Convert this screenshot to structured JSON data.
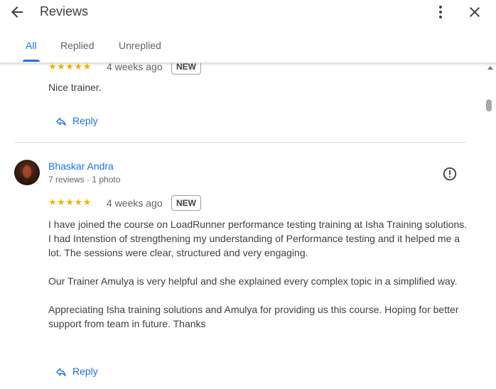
{
  "header": {
    "title": "Reviews",
    "tabs": [
      {
        "label": "All",
        "active": true
      },
      {
        "label": "Replied",
        "active": false
      },
      {
        "label": "Unreplied",
        "active": false
      }
    ]
  },
  "colors": {
    "accent": "#1a73e8",
    "star": "#f4b400"
  },
  "reviews": [
    {
      "stars": "★★★★★",
      "rating": 5,
      "date": "4 weeks ago",
      "badge": "NEW",
      "text": "Nice trainer.",
      "reply_label": "Reply"
    },
    {
      "author": "Bhaskar Andra",
      "meta": "7 reviews · 1 photo",
      "stars": "★★★★★",
      "rating": 5,
      "date": "4 weeks ago",
      "badge": "NEW",
      "text": "I have joined the course on LoadRunner performance testing training at Isha Training solutions. I had Intenstion of strengthening my understanding of Performance testing and it helped me a lot. The sessions were clear, structured and very engaging.\n\nOur Trainer Amulya is very helpful and she explained every complex topic in a simplified way.\n\nAppreciating Isha training solutions and Amulya for providing us this course. Hoping for better support from team in future. Thanks",
      "reply_label": "Reply"
    }
  ],
  "icons": {
    "back": "arrow-back-icon",
    "more": "more-vert-icon",
    "close": "close-icon",
    "reply": "reply-icon",
    "report": "report-icon"
  }
}
